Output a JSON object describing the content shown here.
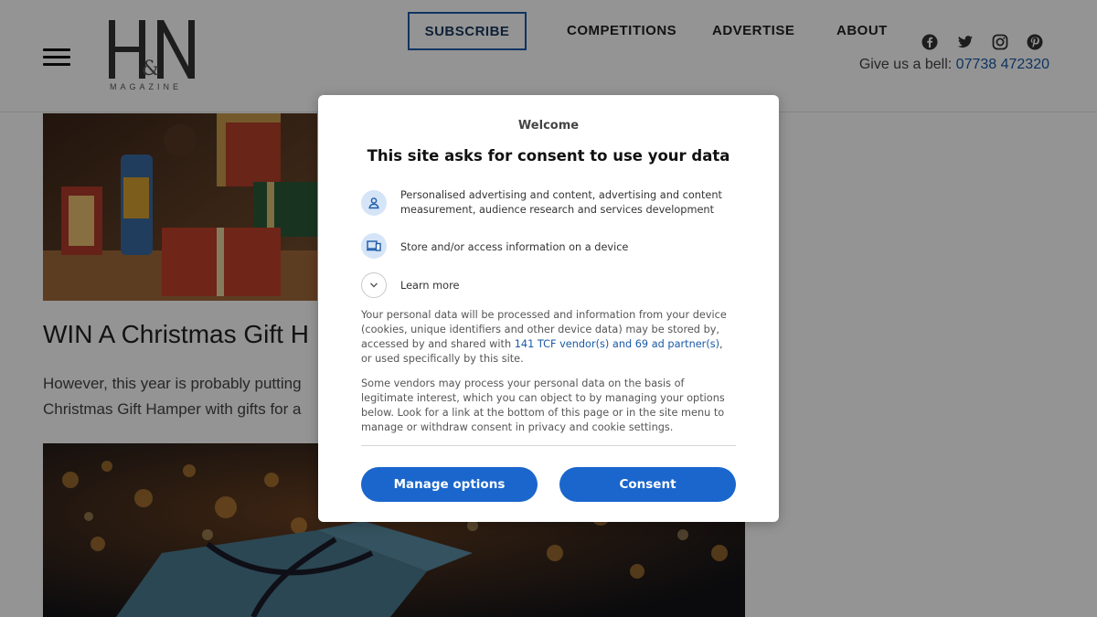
{
  "header": {
    "logo": {
      "letters": "H&N",
      "subtitle": "MAGAZINE"
    },
    "nav": {
      "subscribe": "SUBSCRIBE",
      "competitions": "COMPETITIONS",
      "advertise": "ADVERTISE",
      "about": "ABOUT"
    },
    "social_icons": [
      "facebook-icon",
      "twitter-icon",
      "instagram-icon",
      "pinterest-icon"
    ],
    "phone": {
      "label": "Give us a bell:",
      "number": "07738 472320"
    }
  },
  "article": {
    "title": "WIN A Christmas Gift H",
    "excerpt_line1": "However, this year is probably putting",
    "excerpt_line2": "Christmas Gift Hamper with gifts for a"
  },
  "dialog": {
    "welcome": "Welcome",
    "title": "This site asks for consent to use your data",
    "purposes": [
      {
        "icon": "person-icon",
        "text": "Personalised advertising and content, advertising and content measurement, audience research and services development"
      },
      {
        "icon": "devices-icon",
        "text": "Store and/or access information on a device"
      },
      {
        "icon": "chevron-down-icon",
        "text": "Learn more"
      }
    ],
    "para1_before": "Your personal data will be processed and information from your device (cookies, unique identifiers and other device data) may be stored by, accessed by and shared with ",
    "para1_link": "141 TCF vendor(s) and 69 ad partner(s)",
    "para1_after": ", or used specifically by this site.",
    "para2": "Some vendors may process your personal data on the basis of legitimate interest, which you can object to by managing your options below. Look for a link at the bottom of this page or in the site menu to manage or withdraw consent in privacy and cookie settings.",
    "manage_button": "Manage options",
    "consent_button": "Consent"
  },
  "colors": {
    "accent": "#1a66cc",
    "link": "#1a5aa8",
    "overlay": "rgba(0,0,0,0.42)"
  }
}
